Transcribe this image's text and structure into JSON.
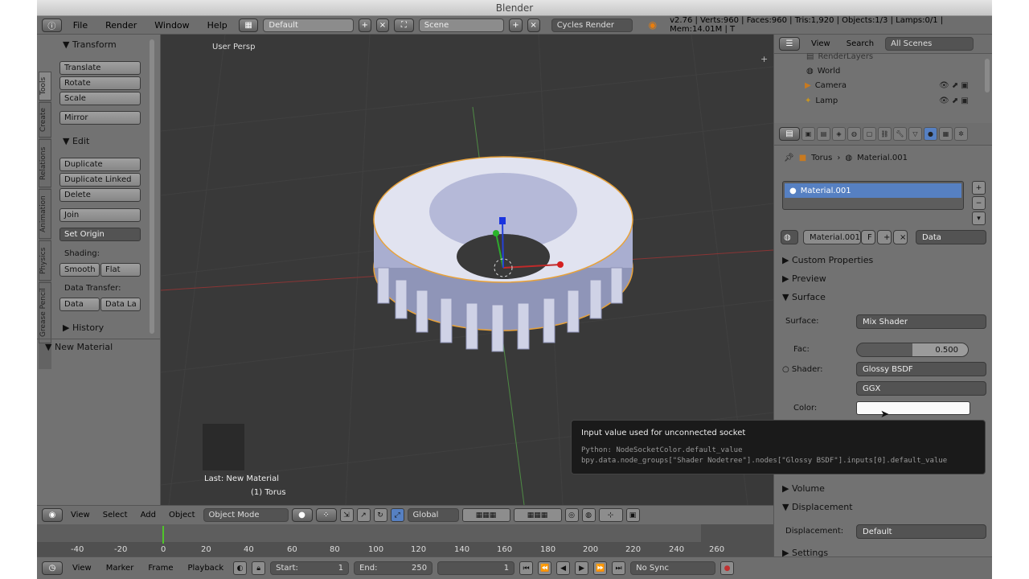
{
  "window": {
    "title": "Blender"
  },
  "menu": {
    "items": [
      "File",
      "Render",
      "Window",
      "Help"
    ],
    "layout": "Default",
    "scene": "Scene",
    "engine": "Cycles Render",
    "stats": "v2.76 | Verts:960 | Faces:960 | Tris:1,920 | Objects:1/3 | Lamps:0/1 | Mem:14.01M | T"
  },
  "tool_shelf": {
    "tabs": [
      "Tools",
      "Create",
      "Relations",
      "Animation",
      "Physics",
      "Grease Pencil"
    ],
    "transform_header": "Transform",
    "transform_buttons": [
      "Translate",
      "Rotate",
      "Scale"
    ],
    "mirror": "Mirror",
    "edit_header": "Edit",
    "edit_buttons": [
      "Duplicate",
      "Duplicate Linked",
      "Delete"
    ],
    "join": "Join",
    "set_origin": "Set Origin",
    "shading_label": "Shading:",
    "smooth": "Smooth",
    "flat": "Flat",
    "data_transfer_label": "Data Transfer:",
    "data": "Data",
    "data_layout": "Data La",
    "history_header": "History",
    "operator_panel": "New Material"
  },
  "viewport": {
    "label": "User Persp",
    "last_op": "Last: New Material",
    "object_label": "(1) Torus"
  },
  "view_header": {
    "items": [
      "View",
      "Select",
      "Add",
      "Object"
    ],
    "mode": "Object Mode",
    "orientation": "Global"
  },
  "timeline": {
    "ticks": [
      "-40",
      "-20",
      "0",
      "20",
      "40",
      "60",
      "80",
      "100",
      "120",
      "140",
      "160",
      "180",
      "200",
      "220",
      "240",
      "260"
    ],
    "current_frame": 0
  },
  "timeline_controls": {
    "items": [
      "View",
      "Marker",
      "Frame",
      "Playback"
    ],
    "start_label": "Start:",
    "start": "1",
    "end_label": "End:",
    "end": "250",
    "current": "1",
    "sync": "No Sync"
  },
  "outliner": {
    "view": "View",
    "search": "Search",
    "scenes": "All Scenes",
    "items": [
      "RenderLayers",
      "World",
      "Camera",
      "Lamp"
    ]
  },
  "properties": {
    "breadcrumb": [
      "Torus",
      "Material.001"
    ],
    "material_slot": "Material.001",
    "material_field": "Material.001",
    "fake_user": "F",
    "link": "Data",
    "sections": {
      "custom_props": "Custom Properties",
      "preview": "Preview",
      "surface": "Surface",
      "volume": "Volume",
      "displacement": "Displacement",
      "settings": "Settings"
    },
    "surface_label": "Surface:",
    "surface_value": "Mix Shader",
    "fac_label": "Fac:",
    "fac_value": "0.500",
    "fac_fraction": 0.5,
    "shader_label": "Shader:",
    "shader_value": "Glossy BSDF",
    "distribution": "GGX",
    "color_label": "Color:",
    "displacement_label": "Displacement:",
    "displacement_value": "Default"
  },
  "tooltip": {
    "title": "Input value used for unconnected socket",
    "python": "Python: NodeSocketColor.default_value",
    "path": "bpy.data.node_groups[\"Shader Nodetree\"].nodes[\"Glossy BSDF\"].inputs[0].default_value"
  },
  "colors": {
    "selection": "#5680c2",
    "viewport_bg": "#393939",
    "x_axis": "#b83a3a",
    "y_axis": "#5aa14a",
    "z_axis": "#2a4fd8"
  }
}
